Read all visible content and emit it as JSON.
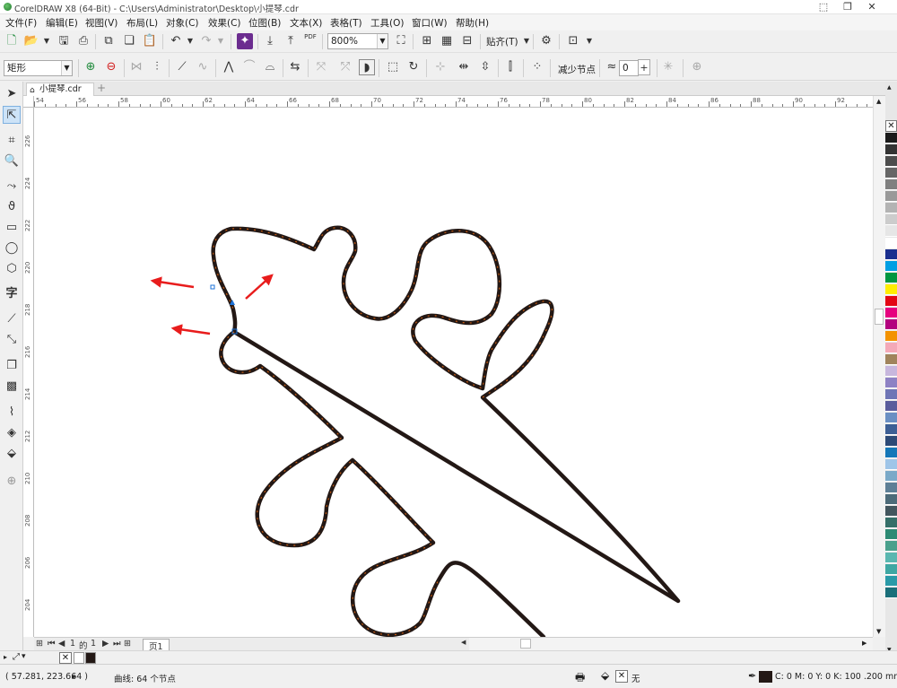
{
  "window": {
    "title": "CorelDRAW X8 (64-Bit) - C:\\Users\\Administrator\\Desktop\\小提琴.cdr",
    "minimize": "⬚",
    "restore": "❐",
    "close": "✕"
  },
  "menu": [
    "文件(F)",
    "编辑(E)",
    "视图(V)",
    "布局(L)",
    "对象(C)",
    "效果(C)",
    "位图(B)",
    "文本(X)",
    "表格(T)",
    "工具(O)",
    "窗口(W)",
    "帮助(H)"
  ],
  "toolbar": {
    "zoom_value": "800%",
    "snap_label": "贴齐(T)",
    "pdf_label": "PDF"
  },
  "property_bar": {
    "selection_mode": "矩形",
    "reduce_nodes_label": "减少节点",
    "smoothness_value": "0"
  },
  "document": {
    "tab_name": "小提琴.cdr"
  },
  "rulers": {
    "horizontal": [
      "54",
      "56",
      "58",
      "60",
      "62",
      "64",
      "66",
      "68",
      "70",
      "72",
      "74",
      "76",
      "78",
      "80",
      "82",
      "84",
      "86",
      "88",
      "90",
      "92"
    ],
    "vertical": [
      "226",
      "224",
      "222",
      "220",
      "218",
      "216",
      "214",
      "212",
      "210",
      "208",
      "206",
      "204"
    ]
  },
  "page_nav": {
    "current": "1",
    "of_label": "的",
    "total": "1",
    "page_tab": "页1"
  },
  "palette_colors": [
    "#1a1a1a",
    "#333333",
    "#4d4d4d",
    "#666666",
    "#808080",
    "#999999",
    "#b3b3b3",
    "#cccccc",
    "#e6e6e6",
    "#ffffff",
    "#1b2f8f",
    "#009fe3",
    "#009640",
    "#ffed00",
    "#e30613",
    "#e6007e",
    "#b3007e",
    "#f39200",
    "#f4a9b8",
    "#a0845c",
    "#c7b7dd",
    "#8e82c4",
    "#6f75b6",
    "#5a5c9c",
    "#6a8fc3",
    "#3d5f95",
    "#2d4a77",
    "#1577b8",
    "#9fc5e8",
    "#7aa9c8",
    "#5e7f96",
    "#4d6b79",
    "#43565e",
    "#356f69",
    "#2d8a74",
    "#4aa08c",
    "#5ab7b0",
    "#3fa7a3",
    "#2a9aa8",
    "#1a6f7a"
  ],
  "status": {
    "coordinates": "( 57.281, 223.664 )",
    "object_info": "曲线: 64 个节点",
    "fill_none": "无",
    "outline_info": "C: 0 M: 0 Y: 0 K: 100  .200 mm"
  },
  "colors": {
    "path_stroke": "#231815",
    "node_color": "#c55a11",
    "arrow_color": "#e81c1c",
    "selected_node": "#1e73d8"
  },
  "icons": {
    "new": "new-document-icon",
    "open": "open-folder-icon",
    "save": "save-icon",
    "print": "print-icon",
    "undo": "undo-icon",
    "redo": "redo-icon",
    "settings": "gear-icon"
  }
}
